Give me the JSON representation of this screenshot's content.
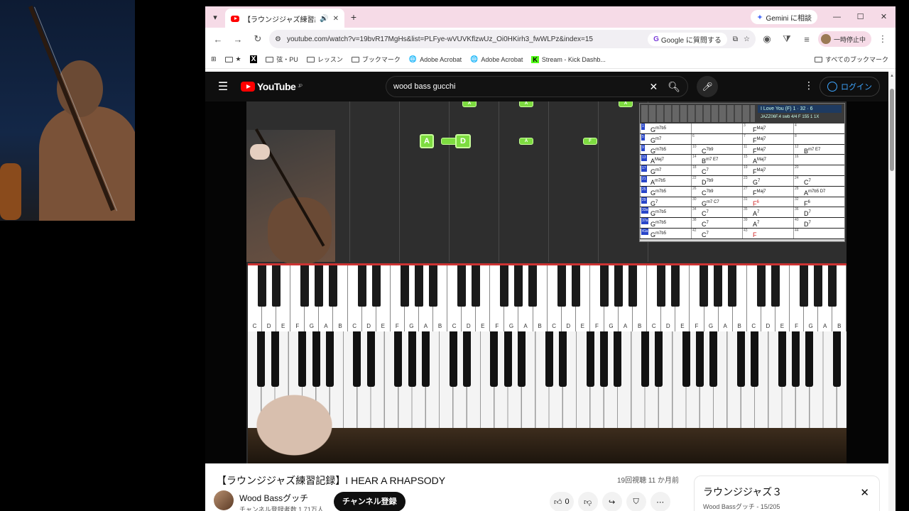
{
  "tab": {
    "title": "【ラウンジジャズ練習記録】I HE",
    "new_tab": "+"
  },
  "gemini": "Gemini に相談",
  "address": {
    "url": "youtube.com/watch?v=19bvR17MgHs&list=PLFye-wVUVKflzwUz_Oi0HKirh3_fwWLPz&index=15",
    "ask_google": "Google に質問する",
    "profile": "一時停止中"
  },
  "bookmarks": {
    "items": [
      "★",
      "弦・PU",
      "レッスン",
      "ブックマーク",
      "Adobe Acrobat",
      "Adobe Acrobat",
      "Stream - Kick Dashb..."
    ],
    "all": "すべてのブックマーク"
  },
  "youtube": {
    "logo": "YouTube",
    "region": "JP",
    "search_value": "wood bass gucchi",
    "login": "ログイン"
  },
  "score": {
    "song": "I Love You (F)  1 · 32 · 6",
    "sub": "JAZZ06F.4 swb  4/4  F  155 1 1X",
    "rows": [
      [
        [
          "1",
          "G",
          "m7b5"
        ],
        [
          "",
          "",
          ""
        ],
        [
          "3",
          "F",
          "Maj7"
        ],
        [
          "4",
          "",
          ""
        ]
      ],
      [
        [
          "5",
          "G",
          "m7"
        ],
        [
          "6",
          "",
          ""
        ],
        [
          "7",
          "F",
          "Maj7"
        ],
        [
          "8",
          "",
          ""
        ]
      ],
      [
        [
          "9",
          "G",
          "m7b5"
        ],
        [
          "10",
          "C",
          "7b9"
        ],
        [
          "11",
          "F",
          "Maj7"
        ],
        [
          "12",
          "B",
          "m7  E7"
        ]
      ],
      [
        [
          "13",
          "A",
          "Maj7"
        ],
        [
          "14",
          "B",
          "m7  E7"
        ],
        [
          "15",
          "A",
          "Maj7"
        ],
        [
          "16",
          "",
          ""
        ]
      ],
      [
        [
          "17",
          "G",
          "m7"
        ],
        [
          "18",
          "C",
          "7"
        ],
        [
          "19",
          "F",
          "Maj7"
        ],
        [
          "20",
          "",
          ""
        ]
      ],
      [
        [
          "21",
          "A",
          "m7b5"
        ],
        [
          "22",
          "D",
          "7b9"
        ],
        [
          "23",
          "G",
          "7"
        ],
        [
          "24",
          "C",
          "7"
        ]
      ],
      [
        [
          "25",
          "G",
          "m7b5"
        ],
        [
          "26",
          "C",
          "7b9"
        ],
        [
          "27",
          "F",
          "Maj7"
        ],
        [
          "28",
          "A",
          "m7b5 D7"
        ]
      ],
      [
        [
          "29",
          "G",
          "7"
        ],
        [
          "30",
          "G",
          "m7  C7"
        ],
        [
          "31",
          "F",
          "6"
        ],
        [
          "32",
          "F",
          "6"
        ]
      ],
      [
        [
          "33a",
          "G",
          "m7b5"
        ],
        [
          "34",
          "C",
          "7"
        ],
        [
          "35",
          "A",
          "7"
        ],
        [
          "36",
          "D",
          "7"
        ]
      ],
      [
        [
          "37a",
          "G",
          "m7b5"
        ],
        [
          "38",
          "C",
          "7"
        ],
        [
          "39",
          "A",
          "7"
        ],
        [
          "40",
          "D",
          "7"
        ]
      ],
      [
        [
          "41a",
          "G",
          "m7b5"
        ],
        [
          "42",
          "C",
          "7"
        ],
        [
          "43",
          "F",
          ""
        ],
        [
          "44",
          "",
          ""
        ]
      ]
    ]
  },
  "keyboard_labels": [
    "C",
    "D",
    "E",
    "F",
    "G",
    "A",
    "B",
    "C",
    "D",
    "E",
    "F",
    "G",
    "A",
    "B",
    "C",
    "D",
    "E",
    "F",
    "G",
    "A",
    "B",
    "C",
    "D",
    "E",
    "F",
    "G",
    "A",
    "B",
    "C",
    "D",
    "E",
    "F",
    "G",
    "A",
    "B",
    "C",
    "D",
    "E",
    "F",
    "G",
    "A",
    "B"
  ],
  "notes": [
    "A",
    "A",
    "A",
    "A",
    "A",
    "F"
  ],
  "video": {
    "title": "【ラウンジジャズ練習記録】I HEAR A RHAPSODY",
    "views": "19回視聴  11 か月前",
    "channel": "Wood Bassグッチ",
    "subscribers": "チャンネル登録者数 1.71万人",
    "subscribe": "チャンネル登録",
    "likes": "0"
  },
  "playlist": {
    "title": "ラウンジジャズ３",
    "subtitle": "Wood Bassグッチ - 15/205"
  }
}
